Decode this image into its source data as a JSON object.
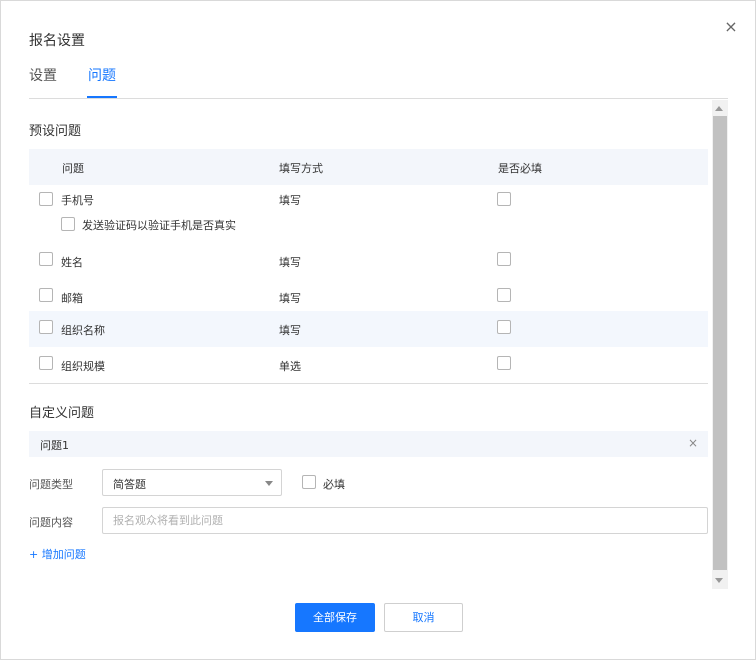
{
  "dialog": {
    "title": "报名设置",
    "close_icon": "×"
  },
  "tabs": [
    {
      "label": "设置",
      "active": false
    },
    {
      "label": "问题",
      "active": true
    }
  ],
  "preset": {
    "section_title": "预设问题",
    "columns": [
      "问题",
      "填写方式",
      "是否必填"
    ],
    "rows": [
      {
        "name": "手机号",
        "method": "填写",
        "selected": false,
        "required": false
      },
      {
        "name": "姓名",
        "method": "填写",
        "selected": false,
        "required": false
      },
      {
        "name": "邮箱",
        "method": "填写",
        "selected": false,
        "required": false
      },
      {
        "name": "组织名称",
        "method": "填写",
        "selected": false,
        "required": false
      },
      {
        "name": "组织规模",
        "method": "单选",
        "selected": false,
        "required": false
      }
    ],
    "phone_verify_label": "发送验证码以验证手机是否真实"
  },
  "custom": {
    "section_title": "自定义问题",
    "question_label": "问题1",
    "remove_icon": "×",
    "type_label": "问题类型",
    "type_value": "简答题",
    "required_label": "必填",
    "content_label": "问题内容",
    "content_placeholder": "报名观众将看到此问题",
    "content_value": "",
    "add_label": "+ 增加问题"
  },
  "footer": {
    "save_all": "全部保存",
    "cancel": "取消"
  },
  "colors": {
    "accent": "#1677ff",
    "table_header_bg": "#f3f6fb",
    "highlight_row_bg": "#f3f7fd"
  }
}
